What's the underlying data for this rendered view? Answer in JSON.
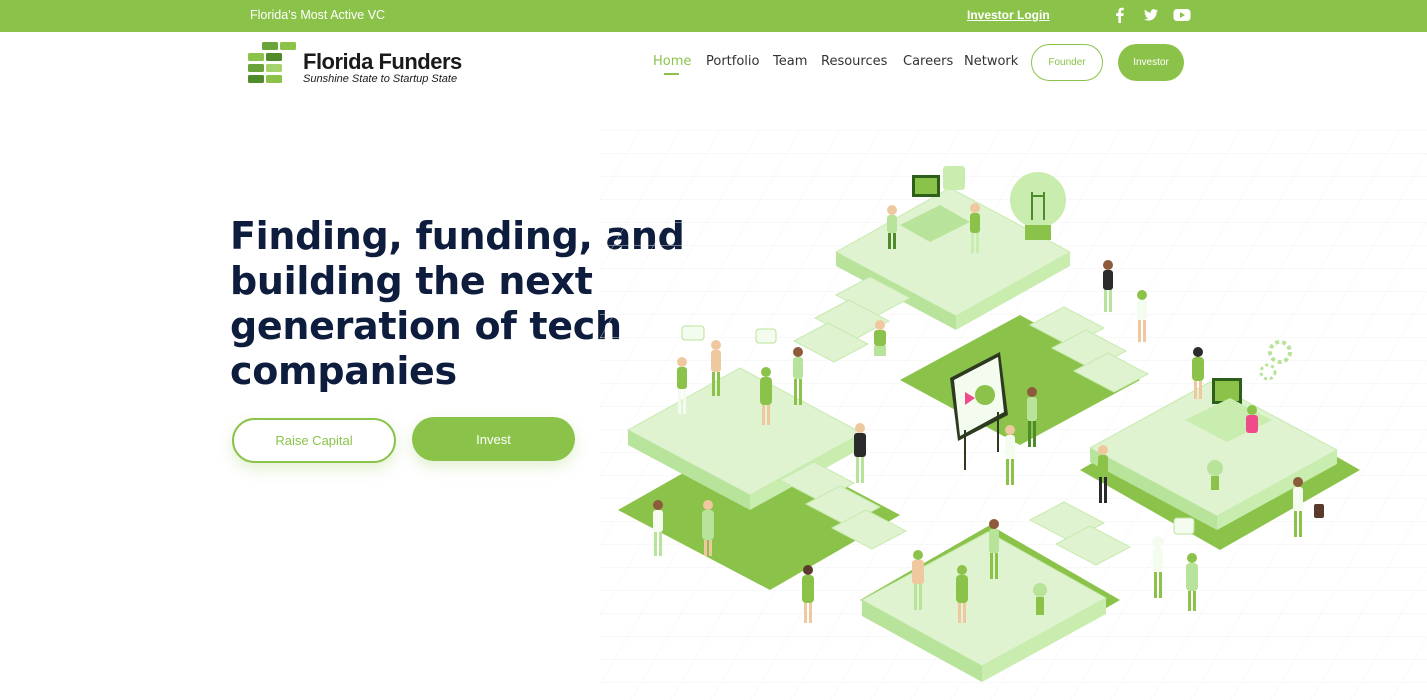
{
  "topbar": {
    "tagline": "Florida's Most Active VC",
    "investor_login": "Investor Login",
    "social": [
      "facebook-icon",
      "twitter-icon",
      "youtube-icon"
    ]
  },
  "brand": {
    "name": "Florida Funders",
    "tagline": "Sunshine State to Startup State"
  },
  "nav": {
    "items": [
      {
        "label": "Home",
        "active": true
      },
      {
        "label": "Portfolio",
        "active": false
      },
      {
        "label": "Team",
        "active": false
      },
      {
        "label": "Resources",
        "active": false
      },
      {
        "label": "Careers",
        "active": false
      },
      {
        "label": "Network",
        "active": false
      }
    ],
    "founder_label": "Founder",
    "investor_label": "Investor"
  },
  "hero": {
    "title": "Finding, funding, and building the next generation of tech companies",
    "raise_label": "Raise Capital",
    "invest_label": "Invest"
  },
  "colors": {
    "accent": "#8bc34a",
    "heading": "#0e1c3d",
    "illustration_light": "#dff3d0",
    "illustration_mid": "#b8e39a"
  }
}
